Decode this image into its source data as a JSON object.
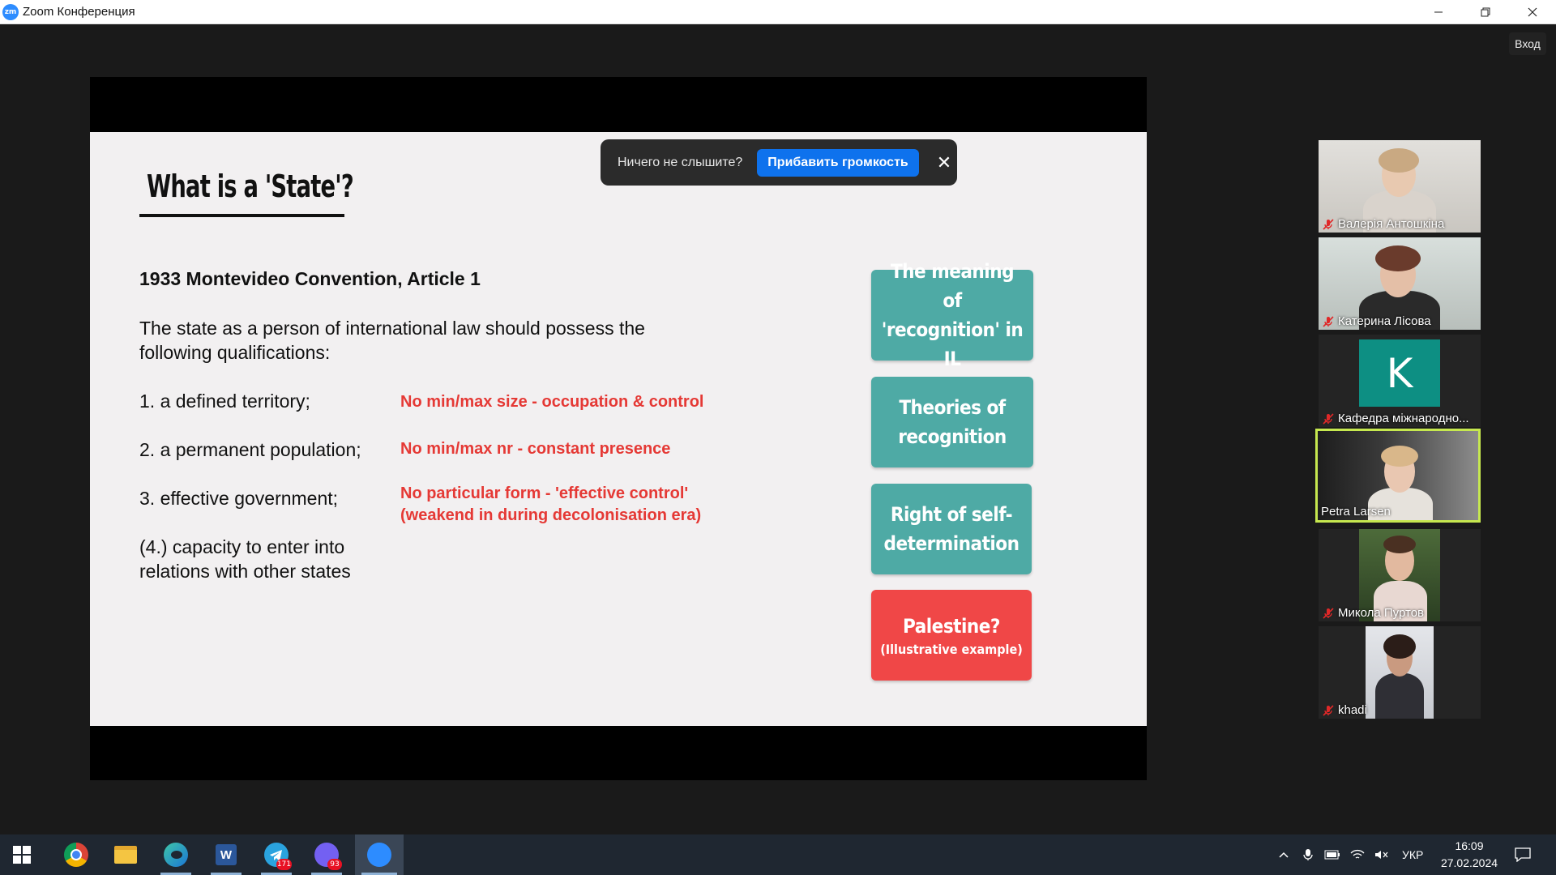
{
  "window": {
    "logo_text": "zm",
    "title": "Zoom Конференция",
    "signin_label": "Вход"
  },
  "toast": {
    "text": "Ничего не слышите?",
    "button": "Прибавить громкость",
    "close": "✕"
  },
  "slide": {
    "title": "What is a 'State'?",
    "heading": "1933 Montevideo Convention, Article 1",
    "intro": "The state as a person of international law should possess the following qualifications:",
    "qualifications": [
      {
        "text": "1. a defined territory;",
        "note": "No min/max size - occupation & control"
      },
      {
        "text": "2. a permanent population;",
        "note": "No min/max nr - constant presence"
      },
      {
        "text": "3. effective government;",
        "note": "No particular form - 'effective control' (weakend in during decolonisation era)"
      },
      {
        "text": "(4.) capacity to enter into relations with other states",
        "note": ""
      }
    ],
    "cards": [
      {
        "label": "The meaning of 'recognition' in IL",
        "color": "#4eaaa5"
      },
      {
        "label": "Theories of recognition",
        "color": "#4eaaa5"
      },
      {
        "label": "Right of self-determination",
        "color": "#4eaaa5"
      },
      {
        "label": "Palestine?",
        "sub": "(Illustrative example)",
        "color": "#f04747"
      }
    ]
  },
  "participants": [
    {
      "name": "Валерія Антошкіна",
      "muted": true
    },
    {
      "name": "Катерина Лісова",
      "muted": true
    },
    {
      "name": "Кафедра міжнародно...",
      "muted": true,
      "initial": "K"
    },
    {
      "name": "Petra Larsen",
      "muted": false,
      "active": true
    },
    {
      "name": "Микола Пуртов",
      "muted": true
    },
    {
      "name": "khadi",
      "muted": true
    }
  ],
  "taskbar": {
    "badges": {
      "telegram": "171",
      "viber": "93"
    },
    "language": "УКР",
    "time": "16:09",
    "date": "27.02.2024"
  }
}
